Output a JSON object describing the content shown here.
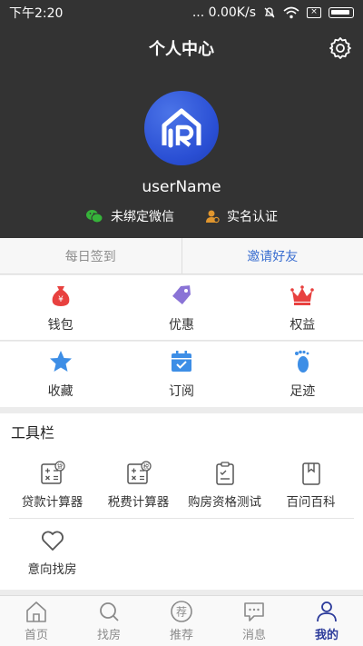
{
  "status": {
    "time": "下午2:20",
    "network": "... 0.00K/s"
  },
  "header": {
    "title": "个人中心",
    "username": "userName",
    "wechat_label": "未绑定微信",
    "realname_label": "实名认证"
  },
  "signbar": {
    "daily": "每日签到",
    "invite": "邀请好友"
  },
  "grid1": [
    {
      "label": "钱包",
      "icon": "money-bag-icon"
    },
    {
      "label": "优惠",
      "icon": "tag-icon"
    },
    {
      "label": "权益",
      "icon": "crown-icon"
    }
  ],
  "grid2": [
    {
      "label": "收藏",
      "icon": "star-icon"
    },
    {
      "label": "订阅",
      "icon": "calendar-check-icon"
    },
    {
      "label": "足迹",
      "icon": "footprint-icon"
    }
  ],
  "tools": {
    "title": "工具栏",
    "items": [
      {
        "label": "贷款计算器",
        "badge": "贷"
      },
      {
        "label": "税费计算器",
        "badge": "税"
      },
      {
        "label": "购房资格测试"
      },
      {
        "label": "百问百科"
      },
      {
        "label": "意向找房"
      }
    ]
  },
  "nav": [
    {
      "label": "首页"
    },
    {
      "label": "找房"
    },
    {
      "label": "推荐",
      "glyph": "荐"
    },
    {
      "label": "消息"
    },
    {
      "label": "我的"
    }
  ],
  "colors": {
    "header": "#333333",
    "accent": "#3a6ed0",
    "nav_active": "#2b3a9a",
    "wallet": "#e8413f",
    "coupon": "#8a73d6",
    "crown": "#e8413f",
    "blue": "#3d8ee6"
  }
}
